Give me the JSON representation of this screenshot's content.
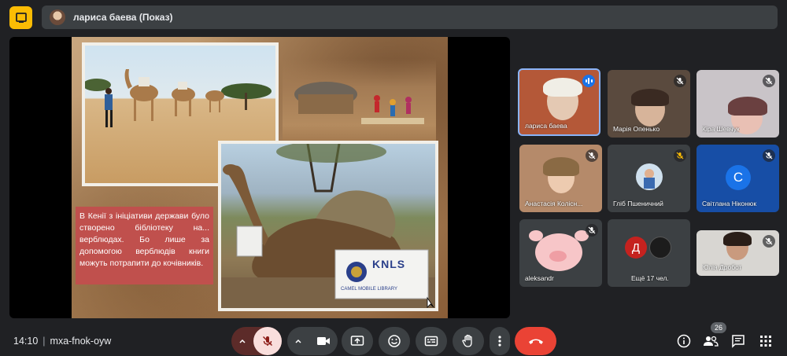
{
  "presenter": {
    "label": "лариса баева (Показ)"
  },
  "slide": {
    "caption": "В Кенії з ініціативи держави було створено бібліотеку на... верблюдах. Бо лише за допомогою верблюдів книги можуть потрапити до кочівників.",
    "box_brand": "KNLS",
    "box_subtext": "CAMEL MOBILE LIBRARY"
  },
  "participants": [
    {
      "name": "лариса баева",
      "speaking": true
    },
    {
      "name": "Марія Опенько",
      "muted": true
    },
    {
      "name": "Кіра Шевчук",
      "muted": true
    },
    {
      "name": "Анастасія Колісн...",
      "muted": true
    },
    {
      "name": "Гліб Пшеничний",
      "muted": true
    },
    {
      "name": "Світлана Ніконюк",
      "muted": true,
      "avatar_letter": "С",
      "avatar_color": "#1a73e8"
    },
    {
      "name": "aleksandr",
      "muted": true
    },
    {
      "name": "Ещё 17 чел.",
      "avatar_letter": "Д",
      "avatar_color": "#c5221f"
    },
    {
      "name": "Юлія Дробот",
      "muted": true
    }
  ],
  "meeting": {
    "time": "14:10",
    "code": "mxa-fnok-oyw",
    "participant_count": "26"
  },
  "colors": {
    "accent": "#8ab4f8",
    "end_call": "#ea4335",
    "mic_off_bg": "#f9dedc",
    "logo": "#fbbc04"
  },
  "icons": [
    "mic-off-icon",
    "videocam-icon",
    "present-screen-icon",
    "emoji-icon",
    "captions-icon",
    "raise-hand-icon",
    "more-vert-icon",
    "call-end-icon",
    "info-icon",
    "people-icon",
    "chat-icon",
    "apps-icon"
  ]
}
